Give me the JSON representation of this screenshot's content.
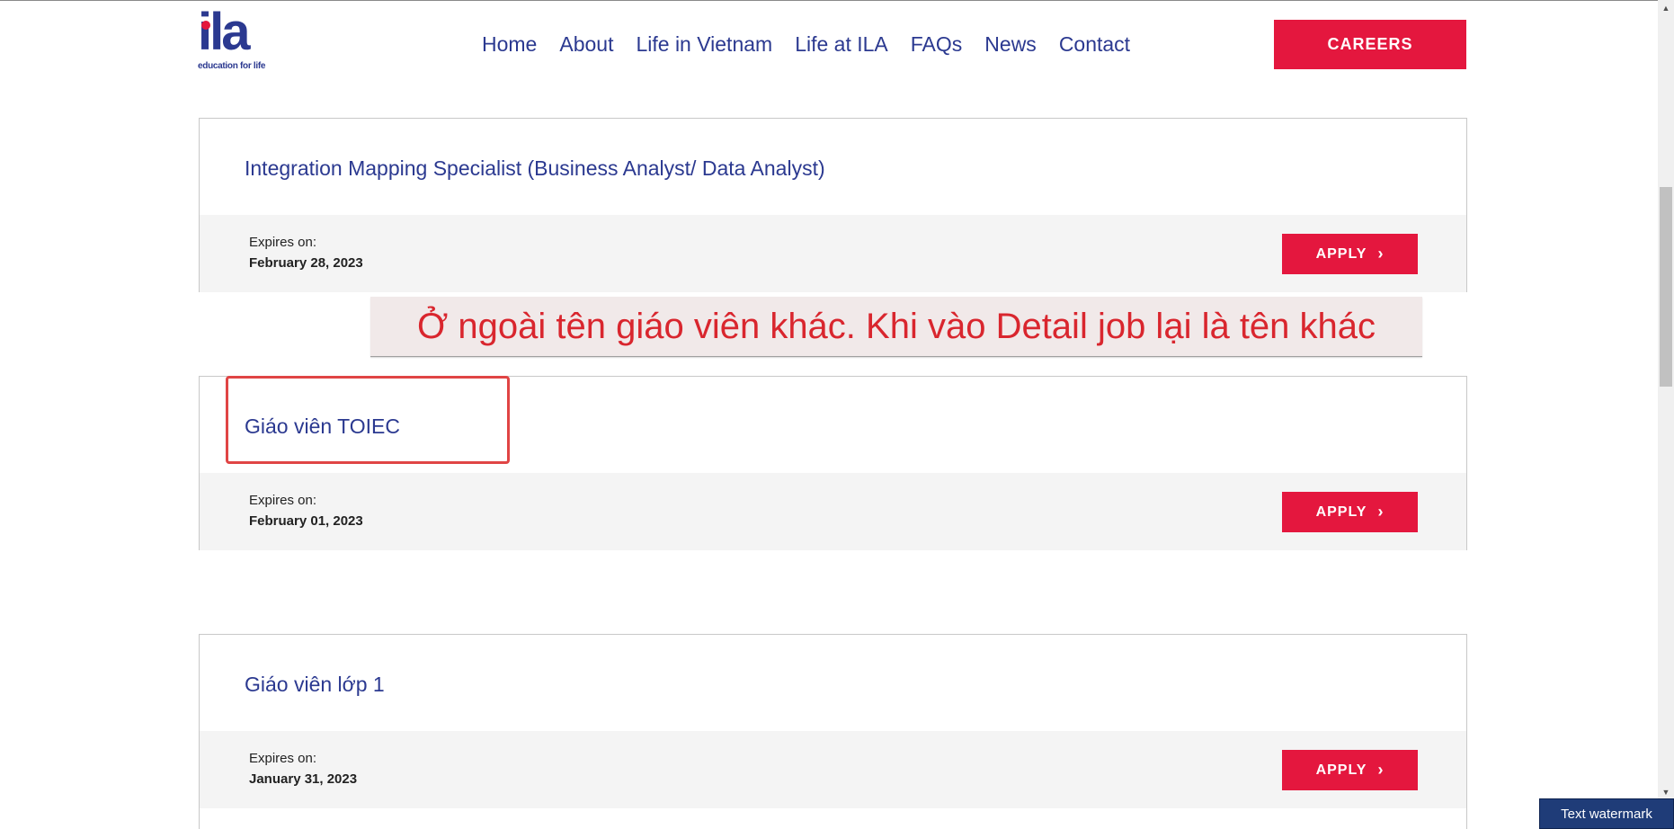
{
  "header": {
    "logo_word": "ila",
    "logo_tagline": "education for life",
    "nav": [
      "Home",
      "About",
      "Life in Vietnam",
      "Life at ILA",
      "FAQs",
      "News",
      "Contact"
    ],
    "careers_label": "CAREERS"
  },
  "jobs": [
    {
      "title": "Integration Mapping Specialist (Business Analyst/ Data Analyst)",
      "expires_label": "Expires on:",
      "expires_date": "February 28, 2023",
      "apply_label": "APPLY"
    },
    {
      "title": "Giáo viên TOIEC",
      "expires_label": "Expires on:",
      "expires_date": "February 01, 2023",
      "apply_label": "APPLY"
    },
    {
      "title": "Giáo viên lớp 1",
      "expires_label": "Expires on:",
      "expires_date": "January 31, 2023",
      "apply_label": "APPLY"
    }
  ],
  "annotation": {
    "text": "Ở ngoài tên giáo viên khác. Khi vào Detail job lại là tên khác"
  },
  "watermark": {
    "text": "Text watermark"
  },
  "colors": {
    "brand_blue": "#2b3990",
    "brand_red": "#e4173e",
    "annotation_red": "#d9262e"
  },
  "icons": {
    "apply_chevron": "chevron-right-icon",
    "scroll_up": "triangle-up-icon",
    "scroll_down": "triangle-down-icon"
  }
}
